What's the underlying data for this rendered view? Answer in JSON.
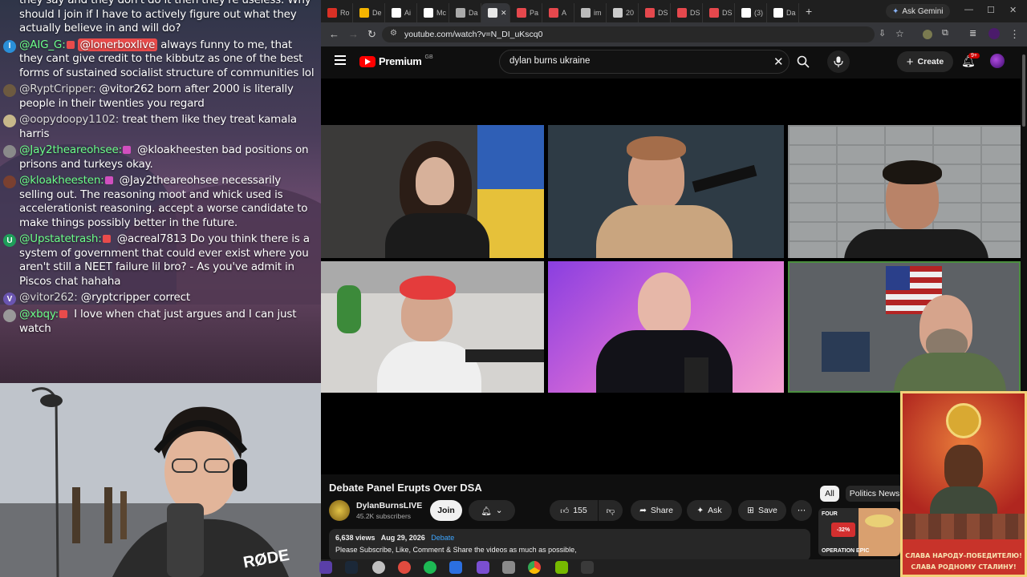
{
  "chat": {
    "messages": [
      {
        "user": "",
        "text": "they say and they don't do it then they're useless. Why should I join if I have to actively figure out what they actually believe in and will do?",
        "user_color": "#ffffff",
        "avatar_color": "#888888"
      },
      {
        "user": "@AIG_G:",
        "mention": "@lonerboxlive",
        "text": "always funny to me, that they cant give credit to the kibbutz as one of the best forms of sustained socialist structure of communities lol",
        "user_color": "#5ef58a",
        "avatar_color": "#2a8fd8",
        "avatar_letter": "I"
      },
      {
        "user": "@RyptCripper:",
        "text": "@vitor262 born after 2000 is literally people in their twenties you regard",
        "user_color": "#d9d9d9",
        "avatar_color": "#6d5a40"
      },
      {
        "user": "@oopydoopy1102:",
        "text": "treat them like they treat kamala harris",
        "user_color": "#d9d9d9",
        "avatar_color": "#c7b88a"
      },
      {
        "user": "@Jay2theareohsee:",
        "text": "@kloakheesten bad positions on prisons and turkeys okay.",
        "user_color": "#5ef58a",
        "avatar_color": "#8a8a8a"
      },
      {
        "user": "@kloakheesten:",
        "text": "@Jay2theareohsee necessarily selling out. The reasoning moot and whick used is accelerationist reasoning. accept a worse candidate to make things possibly better in the future.",
        "user_color": "#5ef58a",
        "avatar_color": "#7a4030"
      },
      {
        "user": "@Upstatetrash:",
        "text": "@acreal7813 Do you think there is a system of government that could ever exist where you aren't still a NEET failure lil bro? - As you've admit in Piscos chat hahaha",
        "user_color": "#5ef58a",
        "avatar_color": "#1f9e5a",
        "avatar_letter": "U"
      },
      {
        "user": "@vitor262:",
        "text": "@ryptcripper correct",
        "user_color": "#d9d9d9",
        "avatar_color": "#6a55b0",
        "avatar_letter": "V"
      },
      {
        "user": "@xbqy:",
        "text": "I love when chat just argues and I can just watch",
        "user_color": "#5ef58a",
        "avatar_color": "#999999"
      }
    ]
  },
  "webcam": {
    "mic_brand": "RØDE"
  },
  "browser": {
    "tabs": [
      "Ro",
      "De",
      "Ai",
      "Mc",
      "Da",
      "",
      "Pa",
      "A",
      "im",
      "20",
      "DS",
      "DS",
      "DS",
      "(3)",
      "Da"
    ],
    "ask_gemini": "Ask Gemini",
    "url": "youtube.com/watch?v=N_DI_uKscq0"
  },
  "youtube": {
    "logo": "Premium",
    "logo_region": "GB",
    "search_value": "dylan burns ukraine",
    "create_label": "Create",
    "notif_count": "9+",
    "video_title": "Debate Panel Erupts Over DSA",
    "channel_name": "DylanBurnsLIVE",
    "subscribers": "45.2K subscribers",
    "join_label": "Join",
    "like_count": "155",
    "share_label": "Share",
    "ask_label": "Ask",
    "save_label": "Save",
    "views": "6,638 views",
    "date": "Aug 29, 2026",
    "tag": "Debate",
    "description": "Please Subscribe, Like, Comment & Share the videos as much as possible,",
    "chips": [
      "All",
      "Politics News"
    ],
    "thumb_text": {
      "top": "FOUR",
      "pct": "-32%",
      "bottom": "OPERATION EPIC"
    }
  },
  "poster": {
    "line1": "СЛАВА НАРОДУ-ПОБЕДИТЕЛЮ!",
    "line2": "СЛАВА РОДНОМУ СТАЛИНУ!"
  },
  "colors": {
    "youtube_red": "#ff0000",
    "chat_green": "#5ef58a",
    "poster_red": "#c8332a"
  }
}
